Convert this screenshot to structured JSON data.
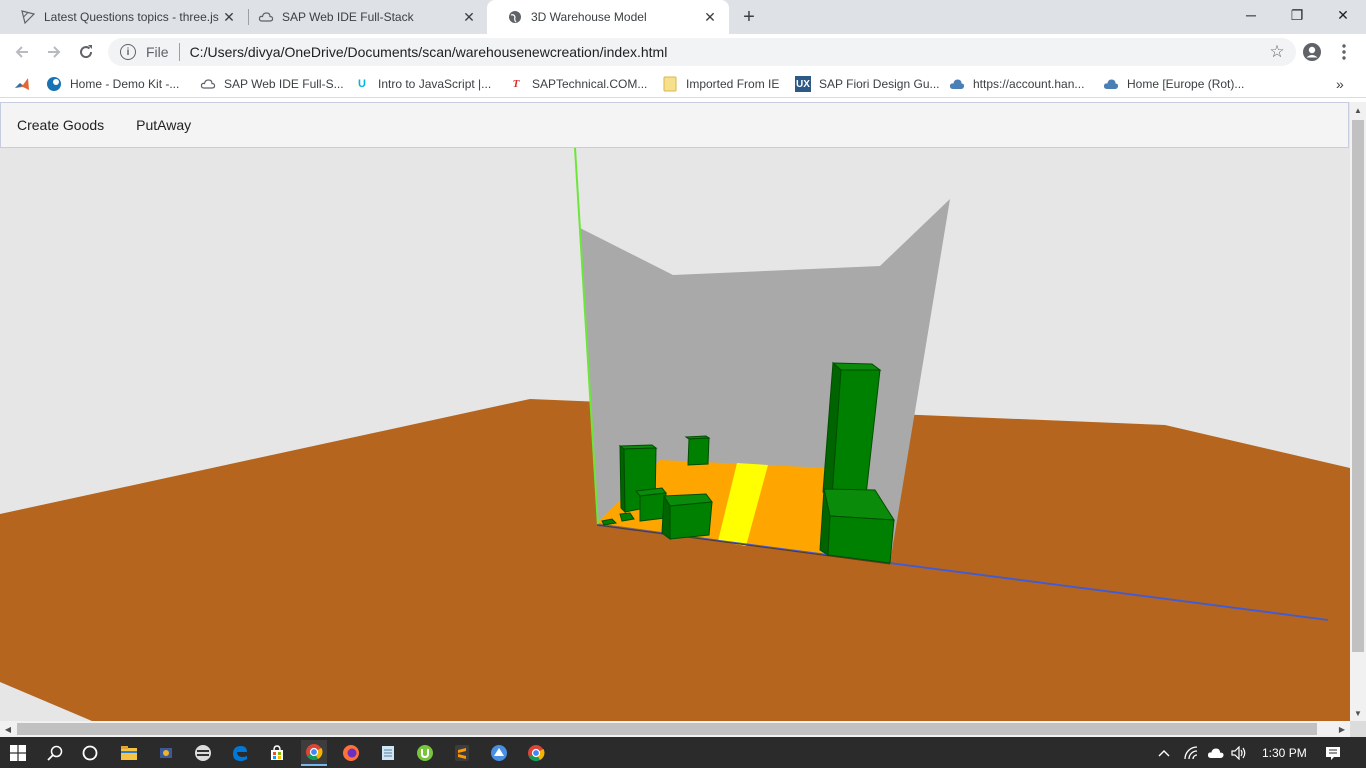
{
  "browser": {
    "tabs": [
      {
        "title": "Latest Questions topics - three.js",
        "icon": "threejs-icon",
        "active": false
      },
      {
        "title": "SAP Web IDE Full-Stack",
        "icon": "cloud-icon",
        "active": false
      },
      {
        "title": "3D Warehouse Model",
        "icon": "globe-icon",
        "active": true
      }
    ],
    "new_tab": "+",
    "window_controls": {
      "minimize": "─",
      "restore": "❐",
      "close": "✕"
    },
    "address": {
      "info": "i",
      "scheme_label": "File",
      "url": "C:/Users/divya/OneDrive/Documents/scan/warehousenewcreation/index.html"
    },
    "bookmarks": [
      {
        "label": "",
        "icon": "matlab-icon"
      },
      {
        "label": "Home - Demo Kit -...",
        "icon": "sap-ui5-icon"
      },
      {
        "label": "SAP Web IDE Full-S...",
        "icon": "cloud-icon"
      },
      {
        "label": "Intro to JavaScript |...",
        "icon": "udacity-icon"
      },
      {
        "label": "SAPTechnical.COM...",
        "icon": "saptechnical-icon"
      },
      {
        "label": "Imported From IE",
        "icon": "folder-icon"
      },
      {
        "label": "SAP Fiori Design Gu...",
        "icon": "ux-icon"
      },
      {
        "label": "https://account.han...",
        "icon": "cloud-icon"
      },
      {
        "label": "Home [Europe (Rot)...",
        "icon": "cloud-icon"
      }
    ],
    "bookmarks_overflow": "»"
  },
  "app": {
    "buttons": [
      {
        "label": "Create Goods"
      },
      {
        "label": "PutAway"
      }
    ]
  },
  "scene": {
    "background": "#e6e6e6",
    "ground_color": "#b5651d",
    "wall_color": "#a9a9a9",
    "floor_color": "#ffa500",
    "aisle_color": "#ffff00",
    "box_color": "#008000",
    "axis_x_color": "#3f5bd6",
    "axis_y_color": "#6de63a"
  },
  "taskbar": {
    "time": "1:30 PM"
  }
}
